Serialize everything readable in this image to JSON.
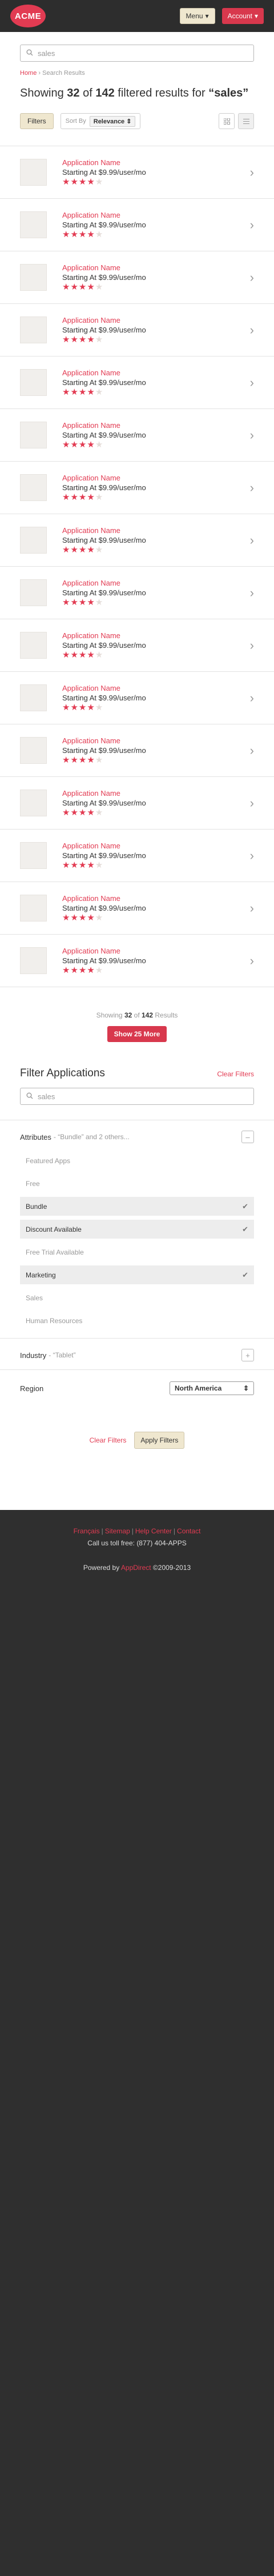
{
  "header": {
    "logo": "ACME",
    "menu_label": "Menu",
    "account_label": "Account"
  },
  "search": {
    "value": "sales",
    "placeholder": "sales"
  },
  "breadcrumb": {
    "home": "Home",
    "separator": "›",
    "current": "Search Results"
  },
  "results": {
    "showing_prefix": "Showing",
    "shown": "32",
    "of": "of",
    "total": "142",
    "suffix": "filtered results for",
    "query": "“sales”"
  },
  "toolbar": {
    "filters_label": "Filters",
    "sort_label": "Sort By",
    "sort_value": "Relevance"
  },
  "apps": [
    {
      "name": "Application Name",
      "price": "Starting At $9.99/user/mo",
      "rating": 4
    },
    {
      "name": "Application Name",
      "price": "Starting At $9.99/user/mo",
      "rating": 4
    },
    {
      "name": "Application Name",
      "price": "Starting At $9.99/user/mo",
      "rating": 4
    },
    {
      "name": "Application Name",
      "price": "Starting At $9.99/user/mo",
      "rating": 4
    },
    {
      "name": "Application Name",
      "price": "Starting At $9.99/user/mo",
      "rating": 4
    },
    {
      "name": "Application Name",
      "price": "Starting At $9.99/user/mo",
      "rating": 4
    },
    {
      "name": "Application Name",
      "price": "Starting At $9.99/user/mo",
      "rating": 4
    },
    {
      "name": "Application Name",
      "price": "Starting At $9.99/user/mo",
      "rating": 4
    },
    {
      "name": "Application Name",
      "price": "Starting At $9.99/user/mo",
      "rating": 4
    },
    {
      "name": "Application Name",
      "price": "Starting At $9.99/user/mo",
      "rating": 4
    },
    {
      "name": "Application Name",
      "price": "Starting At $9.99/user/mo",
      "rating": 4
    },
    {
      "name": "Application Name",
      "price": "Starting At $9.99/user/mo",
      "rating": 4
    },
    {
      "name": "Application Name",
      "price": "Starting At $9.99/user/mo",
      "rating": 4
    },
    {
      "name": "Application Name",
      "price": "Starting At $9.99/user/mo",
      "rating": 4
    },
    {
      "name": "Application Name",
      "price": "Starting At $9.99/user/mo",
      "rating": 4
    },
    {
      "name": "Application Name",
      "price": "Starting At $9.99/user/mo",
      "rating": 4
    }
  ],
  "pager": {
    "prefix": "Showing",
    "shown": "32",
    "of": "of",
    "total": "142",
    "suffix": "Results",
    "show_more": "Show 25 More"
  },
  "filter_panel": {
    "title": "Filter Applications",
    "clear_link": "Clear Filters",
    "search_value": "sales",
    "attributes": {
      "title": "Attributes",
      "summary": "- “Bundle” and 2 others...",
      "toggle": "–",
      "items": [
        {
          "label": "Featured Apps",
          "selected": false
        },
        {
          "label": "Free",
          "selected": false
        },
        {
          "label": "Bundle",
          "selected": true
        },
        {
          "label": "Discount Available",
          "selected": true
        },
        {
          "label": "Free Trial Available",
          "selected": false
        },
        {
          "label": "Marketing",
          "selected": true
        },
        {
          "label": "Sales",
          "selected": false
        },
        {
          "label": "Human Resources",
          "selected": false
        }
      ]
    },
    "industry": {
      "title": "Industry",
      "summary": "- “Tablet”",
      "toggle": "+"
    },
    "region": {
      "title": "Region",
      "value": "North America"
    },
    "clear_filters": "Clear Filters",
    "apply": "Apply Filters"
  },
  "footer": {
    "links": [
      "Français",
      "Sitemap",
      "Help Center",
      "Contact"
    ],
    "toll_free": "Call us toll free: (877) 404-APPS",
    "powered_prefix": "Powered by",
    "powered_brand": "AppDirect",
    "powered_suffix": "©2009-2013"
  },
  "colors": {
    "accent": "#e23b52",
    "header_bg": "#2d2d2d",
    "button_beige": "#efe7cf"
  }
}
